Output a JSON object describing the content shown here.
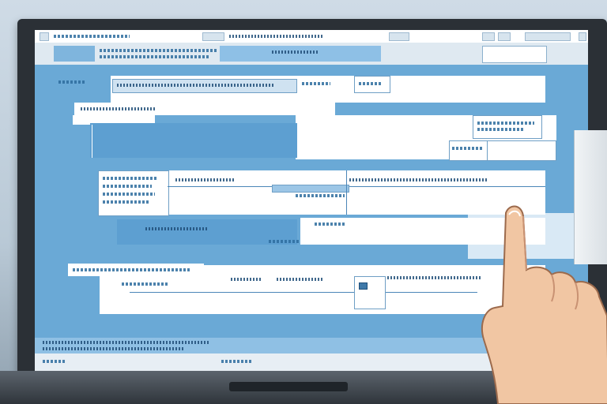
{
  "scene": {
    "description_colors": {
      "screen_background": "#6aa9d6",
      "panel": "#ffffff",
      "accent": "#5d9fd1",
      "bezel": "#2b3036",
      "skin": "#f0c3a0"
    },
    "icons": [
      "monitor-icon",
      "pointing-hand-icon"
    ]
  }
}
